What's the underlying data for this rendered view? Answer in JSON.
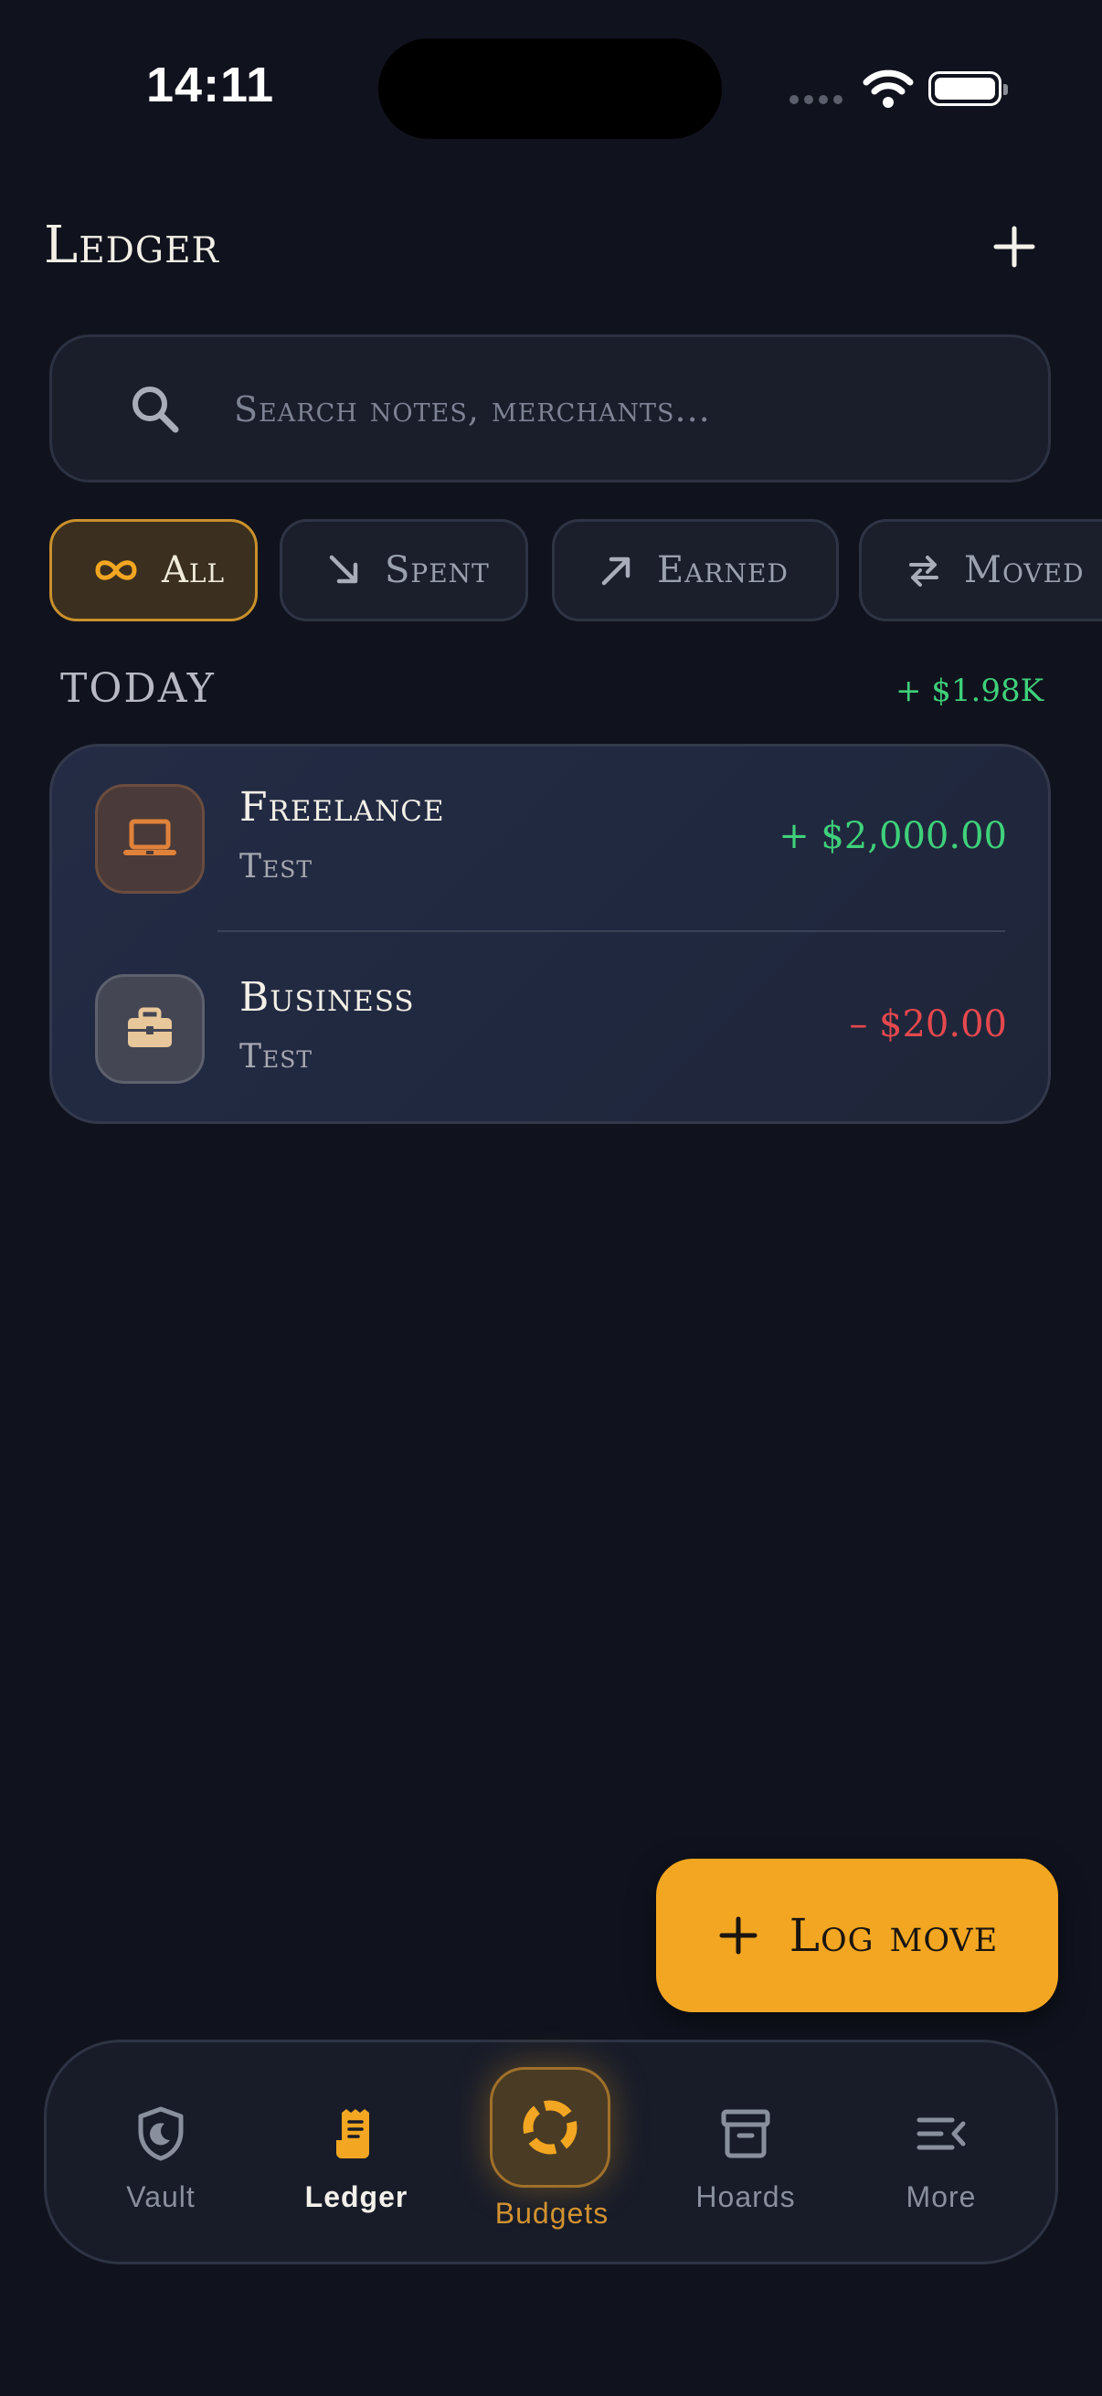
{
  "status_bar": {
    "time": "14:11"
  },
  "header": {
    "title": "Ledger"
  },
  "search": {
    "placeholder": "Search notes, merchants..."
  },
  "filters": [
    {
      "label": "All",
      "icon": "infinity-icon",
      "active": true
    },
    {
      "label": "Spent",
      "icon": "arrow-down-right-icon",
      "active": false
    },
    {
      "label": "Earned",
      "icon": "arrow-up-right-icon",
      "active": false
    },
    {
      "label": "Moved",
      "icon": "swap-arrows-icon",
      "active": false
    }
  ],
  "section": {
    "label": "TODAY",
    "total": "+ $1.98K"
  },
  "transactions": [
    {
      "title": "Freelance",
      "subtitle": "Test",
      "amount": "+ $2,000.00",
      "icon": "laptop-icon"
    },
    {
      "title": "Business",
      "subtitle": "Test",
      "amount": "– $20.00",
      "icon": "briefcase-icon"
    }
  ],
  "fab": {
    "label": "Log move"
  },
  "nav": [
    {
      "label": "Vault",
      "icon": "shield-moon-icon"
    },
    {
      "label": "Ledger",
      "icon": "receipt-icon",
      "active": true
    },
    {
      "label": "Budgets",
      "icon": "ring-chart-icon"
    },
    {
      "label": "Hoards",
      "icon": "archive-box-icon"
    },
    {
      "label": "More",
      "icon": "menu-collapse-icon"
    }
  ],
  "colors": {
    "accent": "#f2a621",
    "income": "#3fd17a",
    "expense": "#e5484d",
    "background": "#10131e"
  }
}
